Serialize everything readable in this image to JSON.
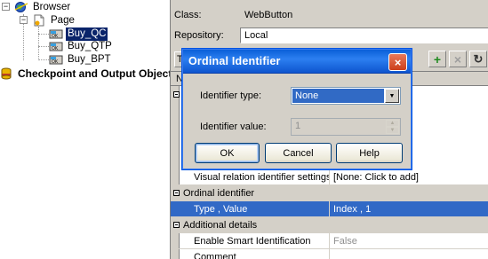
{
  "tree": {
    "browser": "Browser",
    "page": "Page",
    "items": [
      "Buy_QC",
      "Buy_QTP",
      "Buy_BPT"
    ],
    "checkpoint": "Checkpoint and Output Objects"
  },
  "panel": {
    "class_label": "Class:",
    "class_value": "WebButton",
    "repository_label": "Repository:",
    "repository_value": "Local",
    "toolbar": {
      "add": "+",
      "remove": "×",
      "refresh": "↻"
    },
    "truncated_t": "T",
    "truncated_n": "N",
    "grid": {
      "visual_relation_label": "Visual relation identifier settings",
      "visual_relation_value": "[None: Click to add]",
      "ordinal_group": "Ordinal identifier",
      "type_value_label": "Type , Value",
      "type_value_value": "Index , 1",
      "additional_group": "Additional details",
      "smart_id_label": "Enable Smart Identification",
      "smart_id_value": "False",
      "comment_label": "Comment"
    }
  },
  "dialog": {
    "title": "Ordinal Identifier",
    "close": "×",
    "identifier_type_label": "Identifier type:",
    "identifier_type_value": "None",
    "identifier_value_label": "Identifier value:",
    "identifier_value": "1",
    "ok": "OK",
    "cancel": "Cancel",
    "help": "Help"
  },
  "colors": {
    "selection": "#0a246a",
    "grid_selection": "#3169c6",
    "titlebar": "#0a5fd8",
    "panel_bg": "#d4d0c8"
  }
}
